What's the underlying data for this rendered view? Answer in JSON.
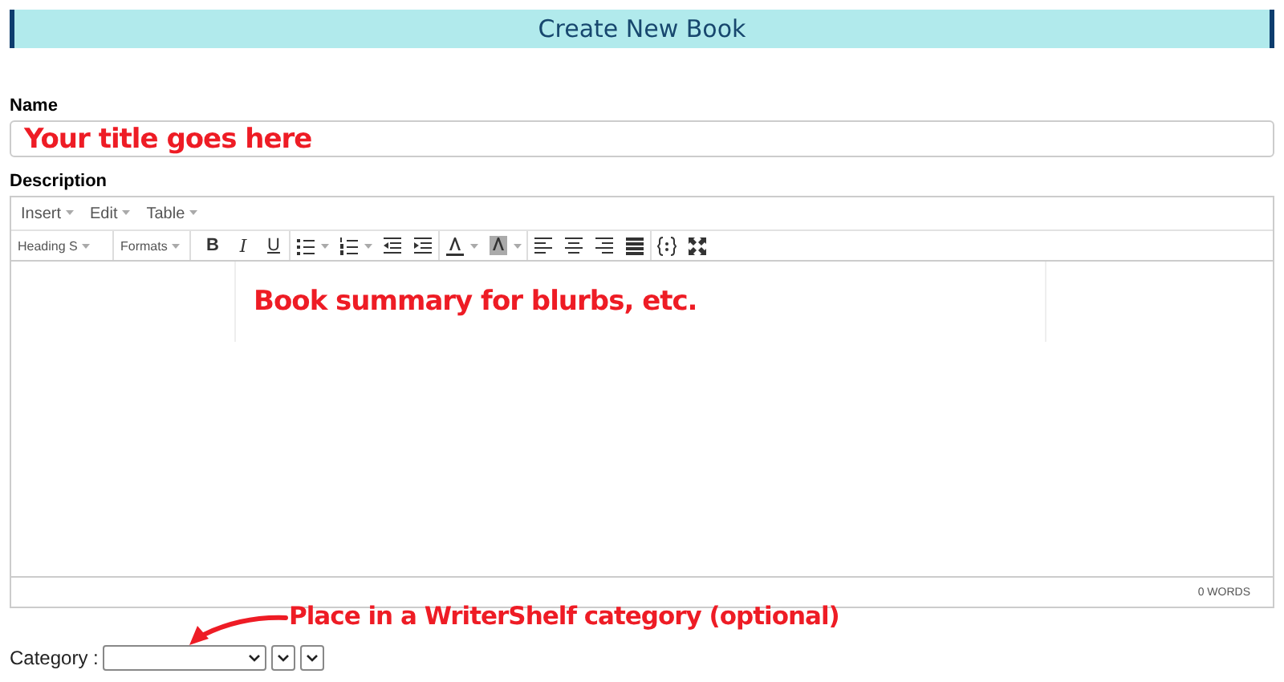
{
  "header": {
    "title": "Create New Book"
  },
  "name_field": {
    "label": "Name",
    "annotation": "Your title goes here"
  },
  "description": {
    "label": "Description",
    "menus": [
      "Insert",
      "Edit",
      "Table"
    ],
    "toolbar": [
      {
        "kind": "dropdown",
        "label": "Heading S"
      },
      {
        "kind": "dropdown",
        "label": "Formats"
      },
      {
        "kind": "letter",
        "label": "B"
      },
      {
        "kind": "letter",
        "label": "I"
      },
      {
        "kind": "letter",
        "label": "U"
      },
      {
        "kind": "icon"
      },
      {
        "kind": "icon"
      },
      {
        "kind": "icon"
      },
      {
        "kind": "icon"
      },
      {
        "kind": "icon"
      },
      {
        "kind": "icon"
      },
      {
        "kind": "icon"
      },
      {
        "kind": "icon"
      },
      {
        "kind": "icon"
      },
      {
        "kind": "icon"
      },
      {
        "kind": "icon"
      },
      {
        "kind": "icon"
      }
    ],
    "annotation": "Book summary for blurbs, etc.",
    "word_count": "0 WORDS"
  },
  "category": {
    "label": "Category :",
    "annotation": "Place in a WriterShelf category (optional)"
  }
}
